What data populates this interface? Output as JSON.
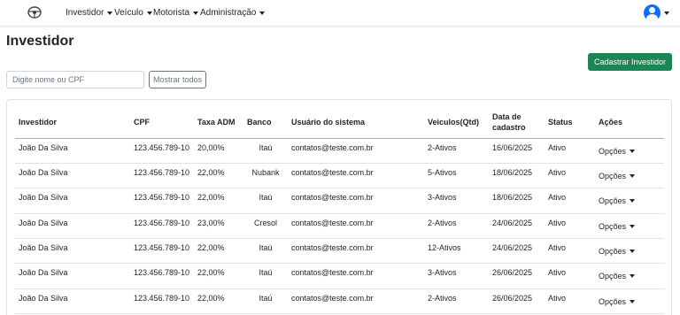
{
  "nav": {
    "menu": [
      {
        "label": "Investidor"
      },
      {
        "label": "Veículo"
      },
      {
        "label": "Motorista"
      },
      {
        "label": "Administração"
      }
    ]
  },
  "page": {
    "title": "Investidor",
    "create_button": "Cadastrar Investidor",
    "search_placeholder": "Digite nome ou CPF",
    "show_all_button": "Mostrar todos"
  },
  "table": {
    "headers": {
      "investidor": "Investidor",
      "cpf": "CPF",
      "taxa": "Taxa ADM",
      "banco": "Banco",
      "usuario": "Usuário do sistema",
      "veiculos": "Veiculos(Qtd)",
      "data": "Data de cadastro",
      "status": "Status",
      "acoes": "Ações"
    },
    "action_label": "Opções",
    "rows": [
      {
        "investidor": "João Da Silva",
        "cpf": "123.456.789-10",
        "taxa": "20,00%",
        "banco": "Itaú",
        "usuario": "contatos@teste.com.br",
        "veiculos": "2-Ativos",
        "data": "16/06/2025",
        "status": "Ativo"
      },
      {
        "investidor": "João Da Silva",
        "cpf": "123.456.789-10",
        "taxa": "22,00%",
        "banco": "Nubank",
        "usuario": "contatos@teste.com.br",
        "veiculos": "5-Ativos",
        "data": "18/06/2025",
        "status": "Ativo"
      },
      {
        "investidor": "João Da Silva",
        "cpf": "123.456.789-10",
        "taxa": "22,00%",
        "banco": "Itaú",
        "usuario": "contatos@teste.com.br",
        "veiculos": "3-Ativos",
        "data": "18/06/2025",
        "status": "Ativo"
      },
      {
        "investidor": "João Da Silva",
        "cpf": "123.456.789-10",
        "taxa": "23,00%",
        "banco": "Cresol",
        "usuario": "contatos@teste.com.br",
        "veiculos": "2-Ativos",
        "data": "24/06/2025",
        "status": "Ativo"
      },
      {
        "investidor": "João Da Silva",
        "cpf": "123.456.789-10",
        "taxa": "22,00%",
        "banco": "Itaú",
        "usuario": "contatos@teste.com.br",
        "veiculos": "12-Ativos",
        "data": "24/06/2025",
        "status": "Ativo"
      },
      {
        "investidor": "João Da Silva",
        "cpf": "123.456.789-10",
        "taxa": "22,00%",
        "banco": "Itaú",
        "usuario": "contatos@teste.com.br",
        "veiculos": "3-Ativos",
        "data": "26/06/2025",
        "status": "Ativo"
      },
      {
        "investidor": "João Da Silva",
        "cpf": "123.456.789-10",
        "taxa": "22,00%",
        "banco": "Itaú",
        "usuario": "contatos@teste.com.br",
        "veiculos": "2-Ativos",
        "data": "26/06/2025",
        "status": "Ativo"
      }
    ]
  },
  "colors": {
    "primary_green": "#198754",
    "avatar_blue": "#0d6efd"
  },
  "icons": {
    "logo": "steering-wheel-icon",
    "avatar": "user-circle-icon",
    "caret": "caret-down-icon"
  }
}
